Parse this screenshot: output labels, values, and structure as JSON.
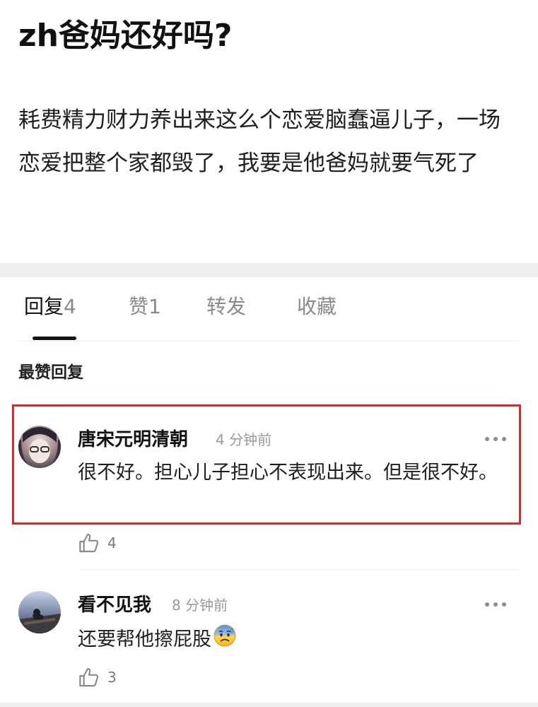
{
  "post": {
    "title": "zh爸妈还好吗?",
    "body": "耗费精力财力养出来这么个恋爱脑蠢逼儿子，一场恋爱把整个家都毁了，我要是他爸妈就要气死了"
  },
  "tabs": [
    {
      "label": "回复",
      "count": "4",
      "active": true
    },
    {
      "label": "赞",
      "count": "1",
      "active": false
    },
    {
      "label": "转发",
      "count": "",
      "active": false
    },
    {
      "label": "收藏",
      "count": "",
      "active": false
    }
  ],
  "section_label": "最赞回复",
  "comments": [
    {
      "username": "唐宋元明清朝",
      "time": "4 分钟前",
      "text": "很不好。担心儿子担心不表现出来。但是很不好。",
      "likes": "4",
      "highlighted": true
    },
    {
      "username": "看不见我",
      "time": "8 分钟前",
      "text": "还要帮他擦屁股",
      "emoji": "anxious-sweat-face",
      "likes": "3",
      "highlighted": false
    }
  ],
  "colors": {
    "highlight_border": "#d8262b",
    "text_primary": "#111111",
    "text_secondary": "#8a8a8a",
    "separator": "#eeeeee"
  }
}
